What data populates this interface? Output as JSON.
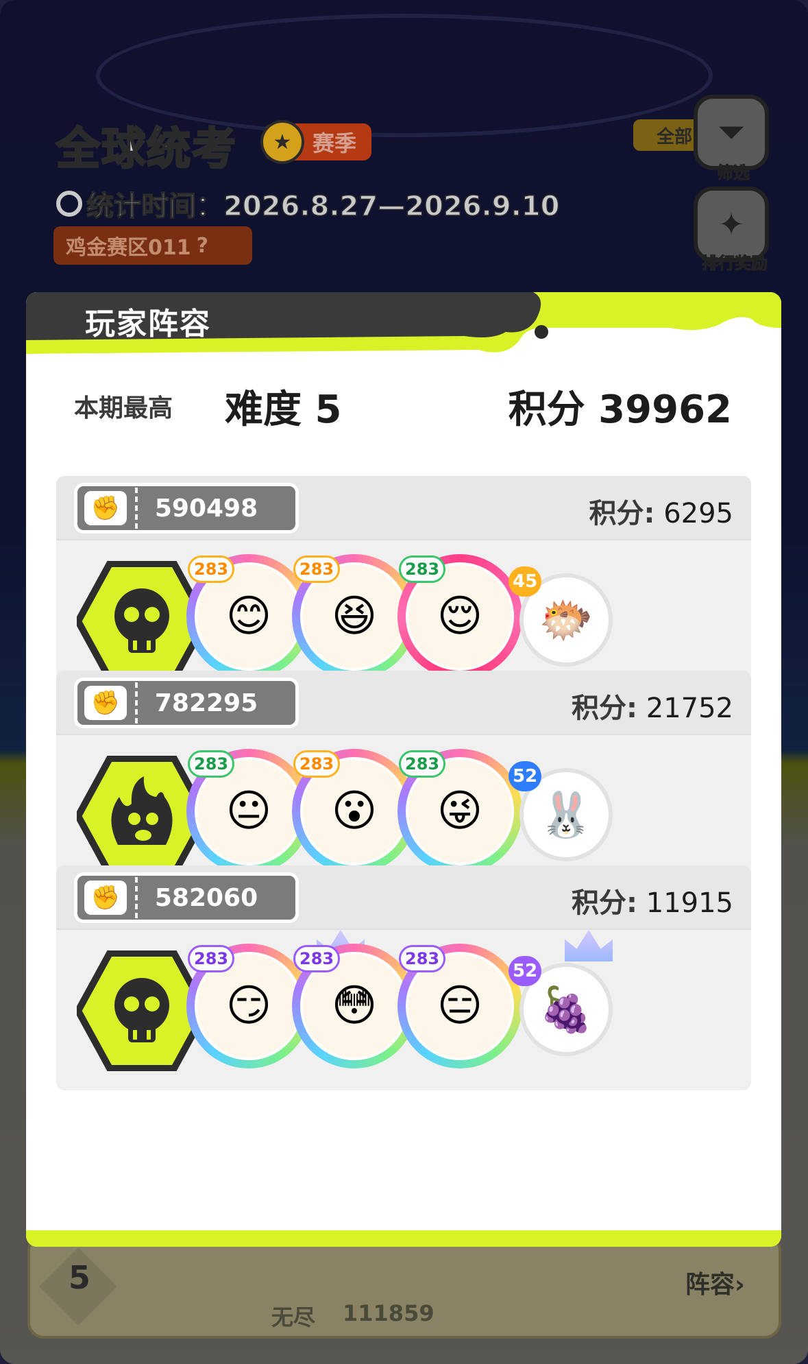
{
  "background": {
    "title": "全球统考",
    "season_label": "赛季",
    "stat_time": "统计时间：2026.8.27—2026.9.10",
    "zone": "鸡金赛区011",
    "filter_pill": "全部",
    "filter_label": "筛选",
    "reward_label": "排行奖励",
    "bottom_rank": "5",
    "bottom_mode": "无尽",
    "bottom_score": "111859",
    "bottom_button": "阵容"
  },
  "modal": {
    "title": "玩家阵容",
    "summary": {
      "label": "本期最高",
      "difficulty": "难度 5",
      "score": "积分 39962"
    },
    "score_key": "积分:",
    "teams": [
      {
        "id": "590498",
        "score": "6295",
        "badge": "skull",
        "heroes": [
          {
            "level": "283",
            "frame": "rainbow",
            "icon": "blonde-hero-icon"
          },
          {
            "level": "283",
            "frame": "rainbow",
            "icon": "orange-hair-hero-icon"
          },
          {
            "level": "283",
            "frame": "pink",
            "icon": "green-hair-hero-icon"
          }
        ],
        "pet": {
          "level": "45",
          "color": "gold",
          "icon": "golden-pufferfish-pet-icon"
        }
      },
      {
        "id": "782295",
        "score": "21752",
        "badge": "flame",
        "heroes": [
          {
            "level": "283",
            "frame": "rainbow",
            "icon": "green-cap-hero-icon"
          },
          {
            "level": "283",
            "frame": "rainbow",
            "icon": "silver-hair-hero-icon"
          },
          {
            "level": "283",
            "frame": "rainbow",
            "icon": "green-hood-hero-icon"
          }
        ],
        "pet": {
          "level": "52",
          "color": "blue",
          "icon": "blue-bunny-pet-icon"
        }
      },
      {
        "id": "582060",
        "score": "11915",
        "badge": "skull",
        "heroes": [
          {
            "level": "283",
            "frame": "rainbow",
            "icon": "dark-hair-hero-icon",
            "crown": true
          },
          {
            "level": "283",
            "frame": "rainbow",
            "icon": "white-curl-hero-icon"
          },
          {
            "level": "283",
            "frame": "rainbow",
            "icon": "silver-mask-hero-icon",
            "crown": true
          }
        ],
        "pet": {
          "level": "52",
          "color": "violet",
          "icon": "grape-sunglasses-pet-icon"
        }
      }
    ]
  },
  "colors": {
    "accent_lime": "#d9f227",
    "ticket_gray": "#7b7b7b",
    "badge_dark": "#2d2d2d"
  }
}
